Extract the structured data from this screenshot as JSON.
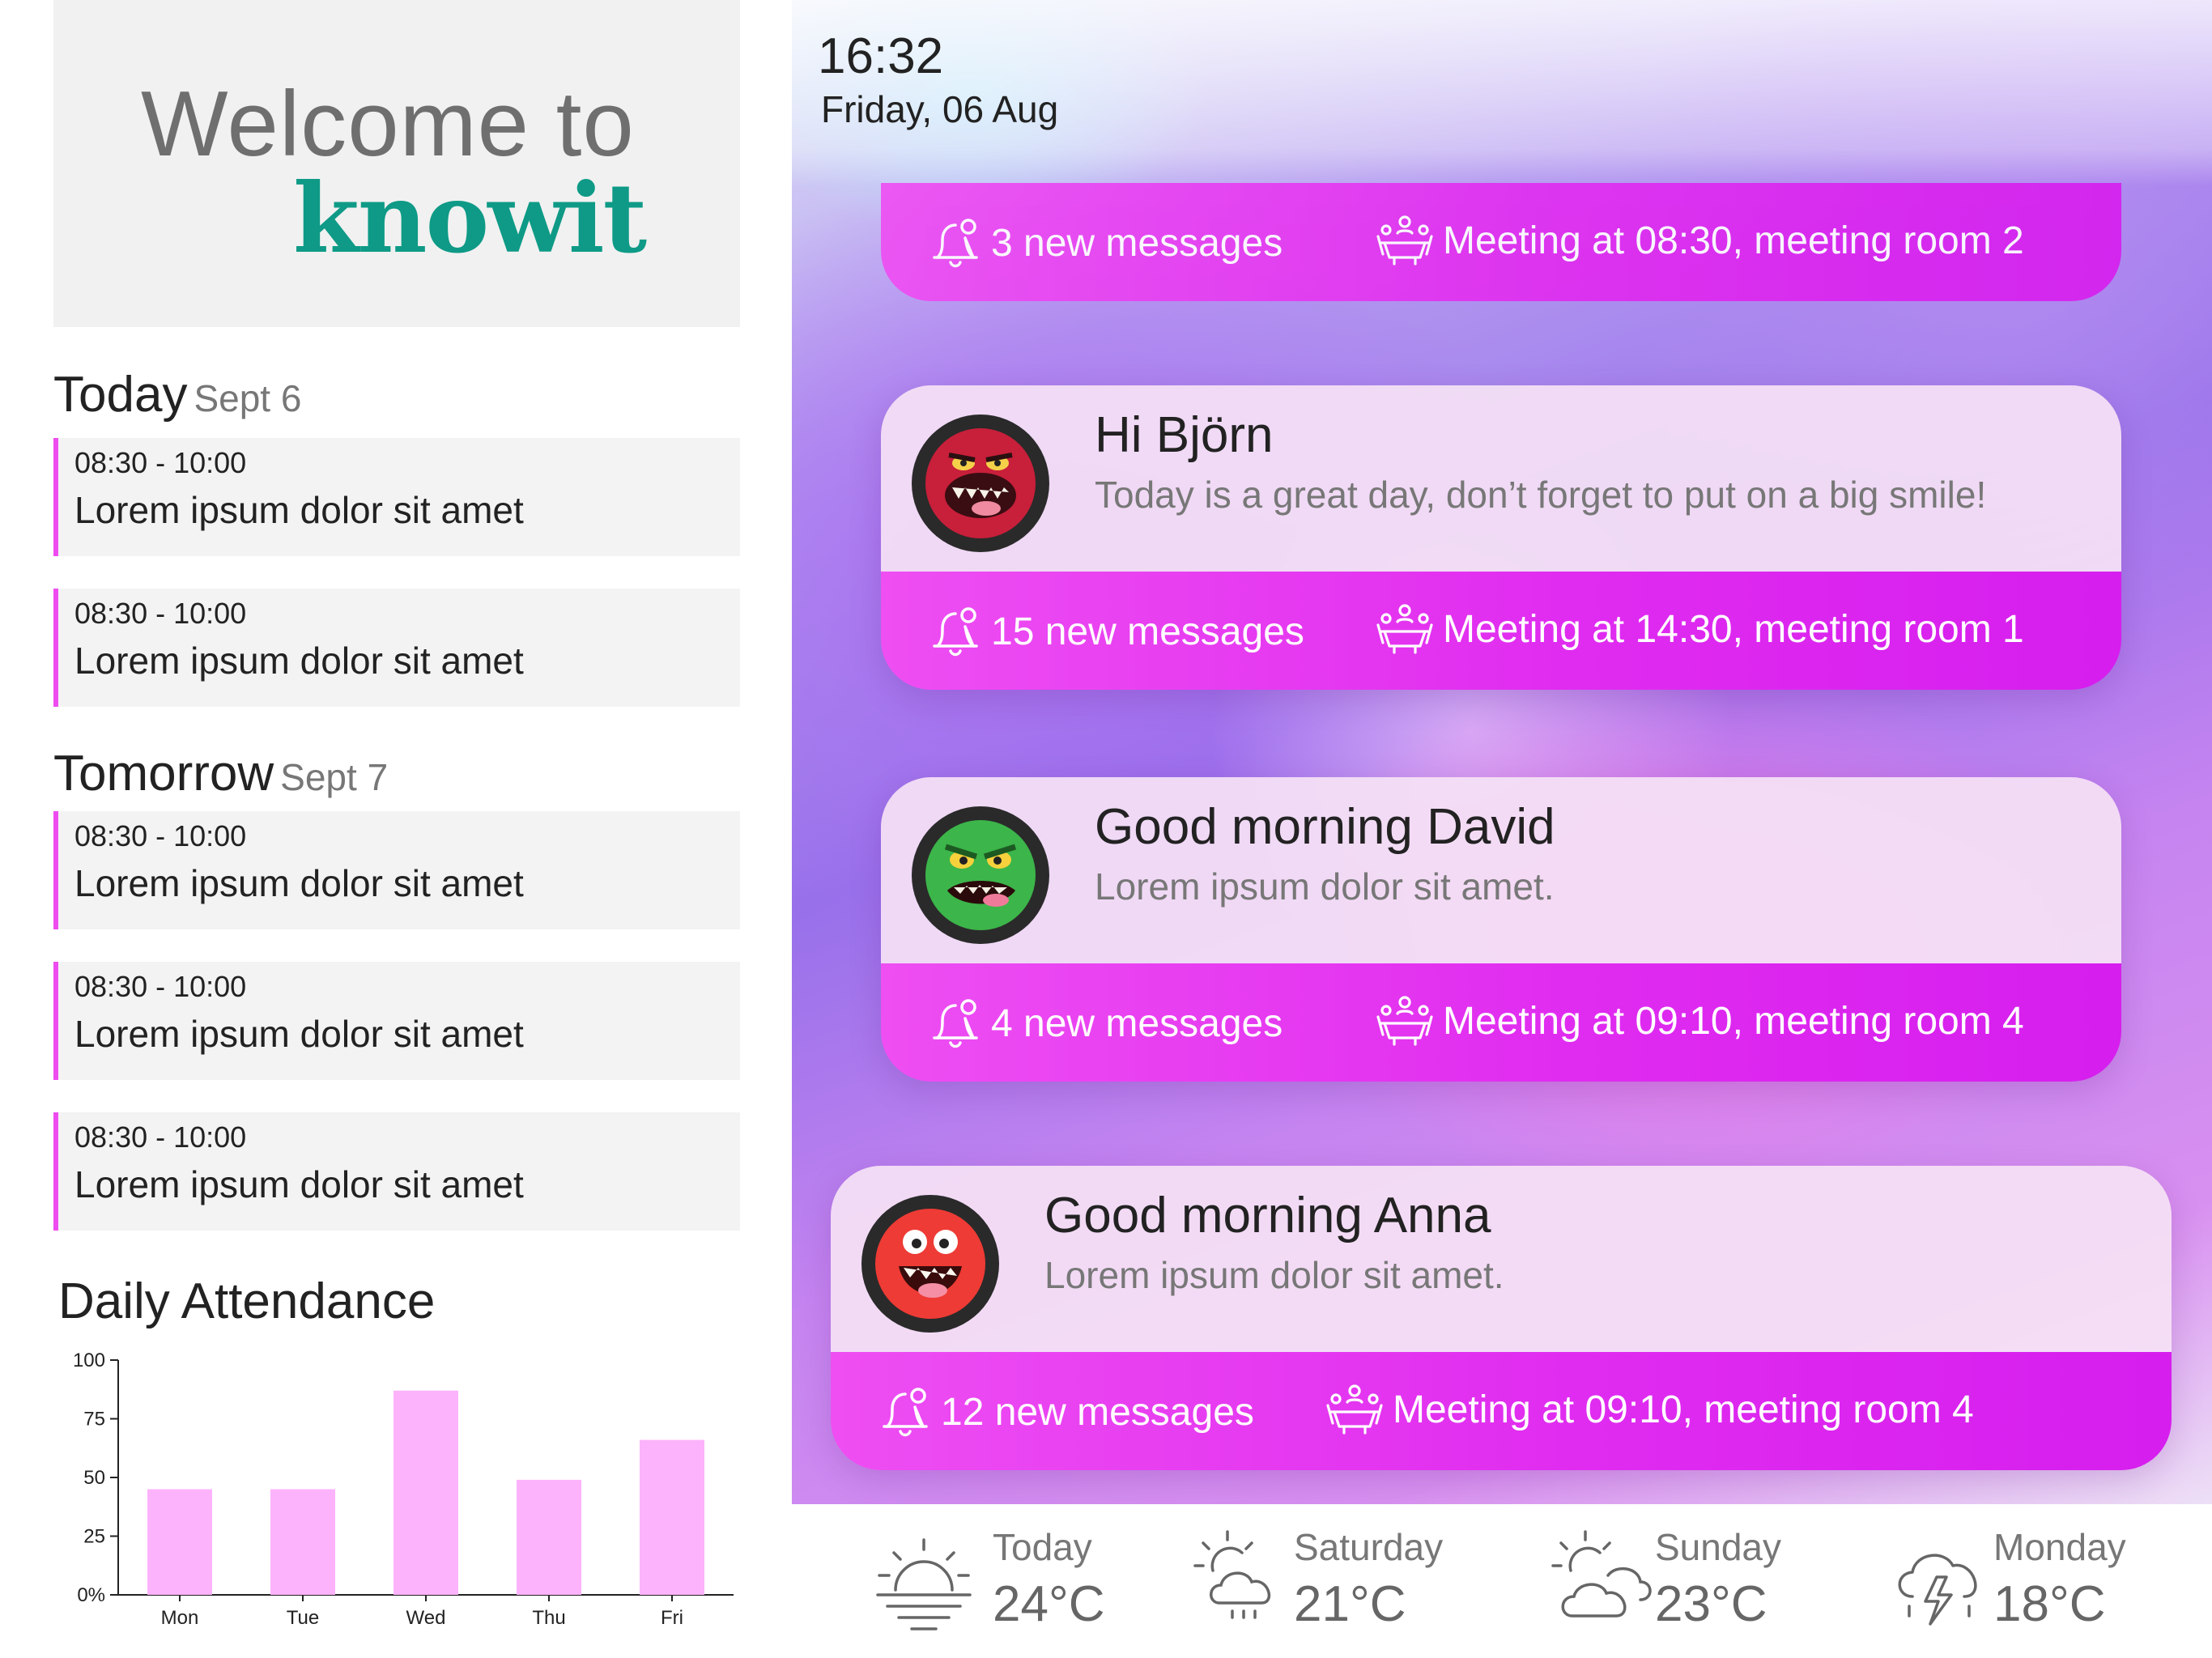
{
  "welcome": {
    "line1": "Welcome to",
    "brand": "knowit"
  },
  "schedule": {
    "today": {
      "label": "Today",
      "date": "Sept 6",
      "events": [
        {
          "time": "08:30 - 10:00",
          "title": "Lorem ipsum dolor sit amet"
        },
        {
          "time": "08:30 - 10:00",
          "title": "Lorem ipsum dolor sit amet"
        }
      ]
    },
    "tomorrow": {
      "label": "Tomorrow",
      "date": "Sept 7",
      "events": [
        {
          "time": "08:30 - 10:00",
          "title": "Lorem ipsum dolor sit amet"
        },
        {
          "time": "08:30 - 10:00",
          "title": "Lorem ipsum dolor sit amet"
        },
        {
          "time": "08:30 - 10:00",
          "title": "Lorem ipsum dolor sit amet"
        }
      ]
    }
  },
  "attendance": {
    "title": "Daily Attendance"
  },
  "chart_data": {
    "type": "bar",
    "title": "Daily Attendance",
    "categories": [
      "Mon",
      "Tue",
      "Wed",
      "Thu",
      "Fri"
    ],
    "values": [
      45,
      45,
      87,
      49,
      66
    ],
    "ylim": [
      0,
      100
    ],
    "yticks": [
      "0%",
      "25",
      "50",
      "75",
      "100"
    ],
    "ytick_values": [
      0,
      25,
      50,
      75,
      100
    ],
    "bar_color": "#fcb3fb",
    "grid": false
  },
  "status": {
    "time": "16:32",
    "date": "Friday, 06 Aug"
  },
  "top_card": {
    "messages": "3 new messages",
    "meeting": "Meeting at 08:30, meeting room 2"
  },
  "cards": [
    {
      "greeting": "Hi Björn",
      "message": "Today is a great day, don’t forget to put on a big smile!",
      "messages": "15 new messages",
      "meeting": "Meeting at 14:30, meeting room 1",
      "avatar": "red-monster"
    },
    {
      "greeting": "Good morning David",
      "message": "Lorem ipsum dolor sit amet.",
      "messages": "4 new messages",
      "meeting": "Meeting at 09:10, meeting room 4",
      "avatar": "green-monster"
    },
    {
      "greeting": "Good morning Anna",
      "message": "Lorem ipsum dolor sit amet.",
      "messages": "12 new messages",
      "meeting": "Meeting at 09:10, meeting room 4",
      "avatar": "red-blob-monster"
    }
  ],
  "weather": [
    {
      "day": "Today",
      "temp": "24°C",
      "icon": "sunrise-icon"
    },
    {
      "day": "Saturday",
      "temp": "21°C",
      "icon": "sun-cloud-rain-icon"
    },
    {
      "day": "Sunday",
      "temp": "23°C",
      "icon": "sun-clouds-icon"
    },
    {
      "day": "Monday",
      "temp": "18°C",
      "icon": "thunderstorm-icon"
    }
  ],
  "colors": {
    "accent": "#ee4cf1",
    "brand": "#0e9a86",
    "card_band": "#e02cf0"
  }
}
